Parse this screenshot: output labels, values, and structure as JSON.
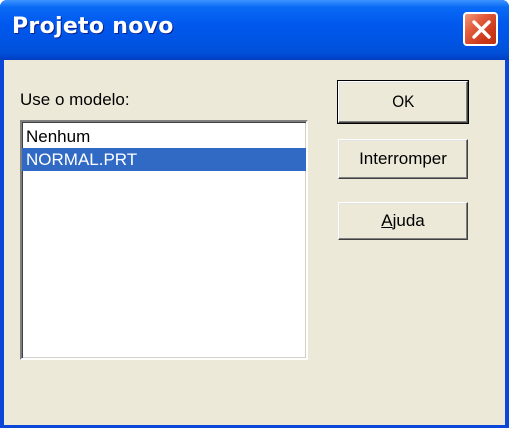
{
  "window": {
    "title": "Projeto novo",
    "close_icon": "close-icon"
  },
  "template": {
    "label": "Use o modelo:",
    "items": [
      {
        "label": "Nenhum",
        "selected": false
      },
      {
        "label": "NORMAL.PRT",
        "selected": true
      }
    ]
  },
  "buttons": {
    "ok": "OK",
    "interromper": "Interromper",
    "ajuda_mnemonic": "A",
    "ajuda_rest": "juda"
  },
  "colors": {
    "title_bar": "#0054e3",
    "close_button": "#e35d3c",
    "dialog_face": "#ece9d8",
    "selection": "#316ac5"
  }
}
